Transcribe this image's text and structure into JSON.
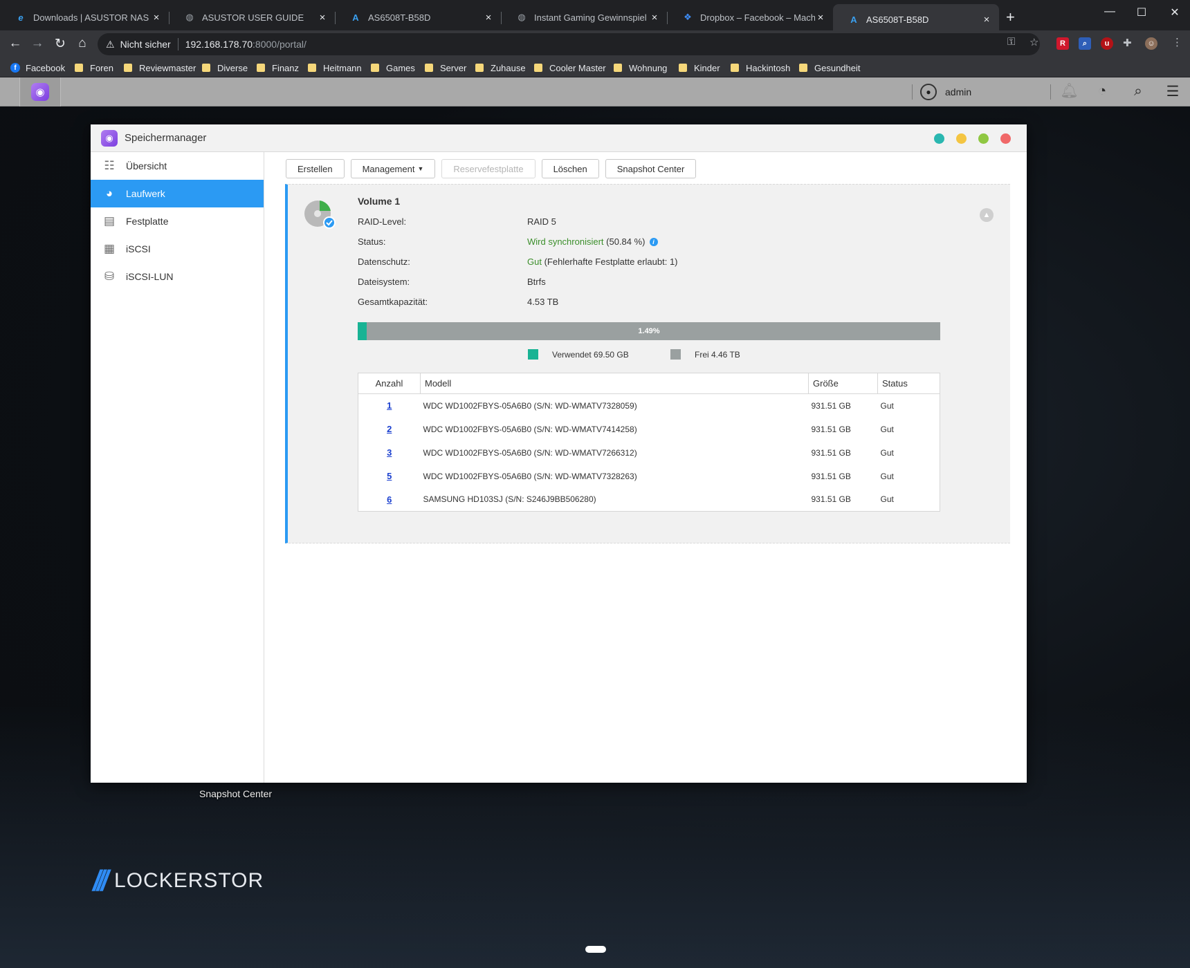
{
  "browser": {
    "tabs": [
      {
        "title": "Downloads | ASUSTOR NAS",
        "icon": "asustor-e-icon",
        "active": false
      },
      {
        "title": "ASUSTOR USER GUIDE",
        "icon": "globe-icon",
        "active": false
      },
      {
        "title": "AS6508T-B58D",
        "icon": "asustor-a-icon",
        "active": false
      },
      {
        "title": "Instant Gaming Gewinnspiel | Ha",
        "icon": "globe-icon",
        "active": false
      },
      {
        "title": "Dropbox – Facebook – Machen S",
        "icon": "dropbox-icon",
        "active": false
      },
      {
        "title": "AS6508T-B58D",
        "icon": "asustor-a-icon",
        "active": true
      }
    ],
    "address": {
      "security_label": "Nicht sicher",
      "host": "192.168.178.70",
      "path": ":8000/portal/"
    },
    "bookmarks": [
      {
        "label": "Facebook",
        "icon": "facebook-icon"
      },
      {
        "label": "Foren",
        "icon": "folder-icon"
      },
      {
        "label": "Reviewmaster",
        "icon": "folder-icon"
      },
      {
        "label": "Diverse",
        "icon": "folder-icon"
      },
      {
        "label": "Finanz",
        "icon": "folder-icon"
      },
      {
        "label": "Heitmann",
        "icon": "folder-icon"
      },
      {
        "label": "Games",
        "icon": "folder-icon"
      },
      {
        "label": "Server",
        "icon": "folder-icon"
      },
      {
        "label": "Zuhause",
        "icon": "folder-icon"
      },
      {
        "label": "Cooler Master",
        "icon": "folder-icon"
      },
      {
        "label": "Wohnung",
        "icon": "folder-icon"
      },
      {
        "label": "Kinder",
        "icon": "folder-icon"
      },
      {
        "label": "Hackintosh",
        "icon": "folder-icon"
      },
      {
        "label": "Gesundheit",
        "icon": "folder-icon"
      }
    ]
  },
  "nas": {
    "user": "admin",
    "desktop_label": "Snapshot Center",
    "brand": "LOCKERSTOR"
  },
  "window": {
    "title": "Speichermanager",
    "dot_colors": [
      "#2ab7b0",
      "#f4c542",
      "#8fc742",
      "#f06868"
    ],
    "sidebar": [
      {
        "label": "Übersicht",
        "icon": "list-icon",
        "active": false
      },
      {
        "label": "Laufwerk",
        "icon": "volume-icon",
        "active": true
      },
      {
        "label": "Festplatte",
        "icon": "hard-disk-icon",
        "active": false
      },
      {
        "label": "iSCSI",
        "icon": "iscsi-icon",
        "active": false
      },
      {
        "label": "iSCSI-LUN",
        "icon": "database-icon",
        "active": false
      }
    ],
    "toolbar": {
      "create": "Erstellen",
      "management": "Management",
      "spare": "Reservefestplatte",
      "delete": "Löschen",
      "snapshot": "Snapshot Center"
    },
    "volume": {
      "name": "Volume 1",
      "labels": {
        "raid": "RAID-Level:",
        "status": "Status:",
        "protection": "Datenschutz:",
        "filesystem": "Dateisystem:",
        "capacity": "Gesamtkapazität:"
      },
      "raid": "RAID 5",
      "status_main": "Wird synchronisiert",
      "status_extra": " (50.84 %)",
      "protection_main": "Gut",
      "protection_extra": " (Fehlerhafte Festplatte erlaubt: 1)",
      "filesystem": "Btrfs",
      "capacity": "4.53 TB",
      "usage_percent": 1.49,
      "usage_label": "1.49%",
      "used_label": "Verwendet 69.50 GB",
      "free_label": "Frei 4.46 TB",
      "used_color": "#19b394",
      "free_color": "#9aa0a0",
      "columns": [
        "Anzahl",
        "Modell",
        "Größe",
        "Status"
      ],
      "disks": [
        {
          "num": "1",
          "model": "WDC WD1002FBYS-05A6B0 (S/N: WD-WMATV7328059)",
          "size": "931.51 GB",
          "status": "Gut"
        },
        {
          "num": "2",
          "model": "WDC WD1002FBYS-05A6B0 (S/N: WD-WMATV7414258)",
          "size": "931.51 GB",
          "status": "Gut"
        },
        {
          "num": "3",
          "model": "WDC WD1002FBYS-05A6B0 (S/N: WD-WMATV7266312)",
          "size": "931.51 GB",
          "status": "Gut"
        },
        {
          "num": "5",
          "model": "WDC WD1002FBYS-05A6B0 (S/N: WD-WMATV7328263)",
          "size": "931.51 GB",
          "status": "Gut"
        },
        {
          "num": "6",
          "model": "SAMSUNG HD103SJ (S/N: S246J9BB506280)",
          "size": "931.51 GB",
          "status": "Gut"
        }
      ]
    }
  }
}
